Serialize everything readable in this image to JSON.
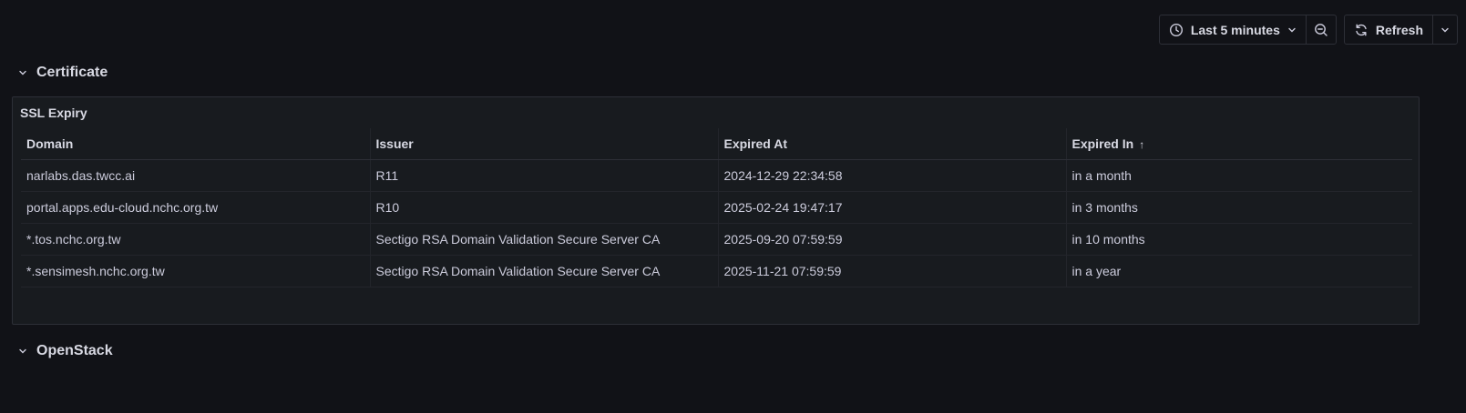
{
  "toolbar": {
    "time_range_label": "Last 5 minutes",
    "refresh_label": "Refresh"
  },
  "rows": {
    "certificate": "Certificate",
    "openstack": "OpenStack"
  },
  "panel": {
    "title": "SSL Expiry",
    "columns": [
      "Domain",
      "Issuer",
      "Expired At",
      "Expired In"
    ],
    "sort_indicator": "↑",
    "records": [
      [
        "narlabs.das.twcc.ai",
        "R11",
        "2024-12-29 22:34:58",
        "in a month"
      ],
      [
        "portal.apps.edu-cloud.nchc.org.tw",
        "R10",
        "2025-02-24 19:47:17",
        "in 3 months"
      ],
      [
        "*.tos.nchc.org.tw",
        "Sectigo RSA Domain Validation Secure Server CA",
        "2025-09-20 07:59:59",
        "in 10 months"
      ],
      [
        "*.sensimesh.nchc.org.tw",
        "Sectigo RSA Domain Validation Secure Server CA",
        "2025-11-21 07:59:59",
        "in a year"
      ]
    ]
  },
  "icons": {
    "clock": "clock-icon",
    "chevron": "chevron-down-icon",
    "zoom_out": "zoom-out-icon",
    "refresh": "refresh-icon"
  }
}
